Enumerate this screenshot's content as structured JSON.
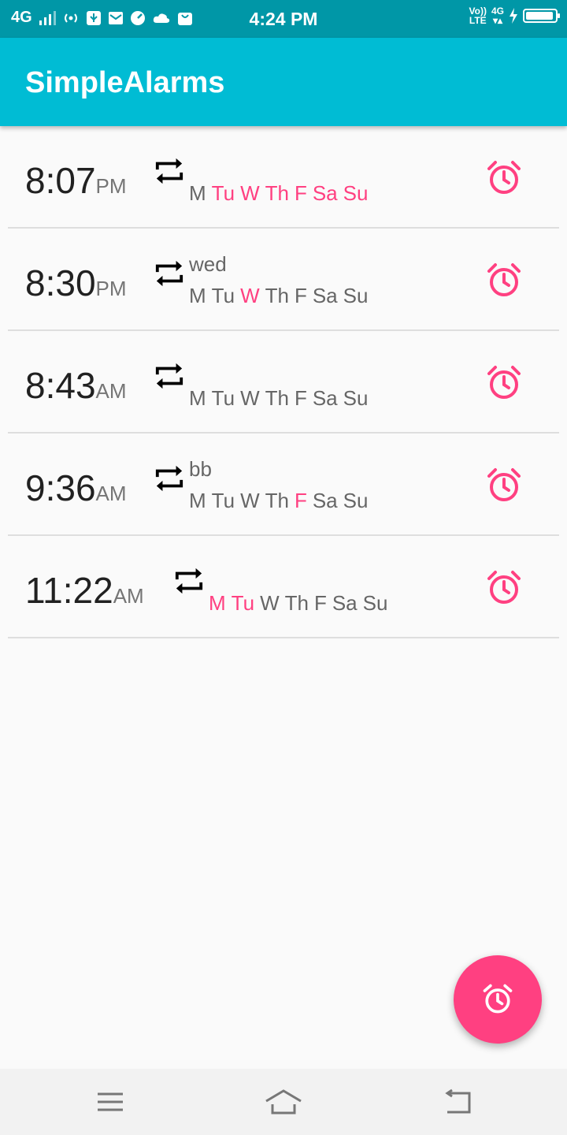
{
  "status_bar": {
    "network": "4G",
    "time": "4:24 PM",
    "volte_top": "Vo))",
    "volte_bottom": "LTE",
    "network_right": "4G",
    "battery_level": 0.95
  },
  "app_bar": {
    "title": "SimpleAlarms"
  },
  "alarms": [
    {
      "time": "8:07",
      "ampm": "PM",
      "label": "",
      "days": [
        "M",
        "Tu",
        "W",
        "Th",
        "F",
        "Sa",
        "Su"
      ],
      "active": [
        false,
        true,
        true,
        true,
        true,
        true,
        true
      ]
    },
    {
      "time": "8:30",
      "ampm": "PM",
      "label": "wed",
      "days": [
        "M",
        "Tu",
        "W",
        "Th",
        "F",
        "Sa",
        "Su"
      ],
      "active": [
        false,
        false,
        true,
        false,
        false,
        false,
        false
      ]
    },
    {
      "time": "8:43",
      "ampm": "AM",
      "label": "",
      "days": [
        "M",
        "Tu",
        "W",
        "Th",
        "F",
        "Sa",
        "Su"
      ],
      "active": [
        false,
        false,
        false,
        false,
        false,
        false,
        false
      ]
    },
    {
      "time": "9:36",
      "ampm": "AM",
      "label": "bb",
      "days": [
        "M",
        "Tu",
        "W",
        "Th",
        "F",
        "Sa",
        "Su"
      ],
      "active": [
        false,
        false,
        false,
        false,
        true,
        false,
        false
      ]
    },
    {
      "time": "11:22",
      "ampm": "AM",
      "label": "",
      "days": [
        "M",
        "Tu",
        "W",
        "Th",
        "F",
        "Sa",
        "Su"
      ],
      "active": [
        true,
        true,
        false,
        false,
        false,
        false,
        false
      ]
    }
  ],
  "colors": {
    "accent": "#ff4081",
    "primary": "#00bcd4",
    "primary_dark": "#0097a7"
  },
  "icons": {
    "repeat": "repeat-icon",
    "alarm": "alarm-clock-icon",
    "fab": "add-alarm-icon",
    "nav": [
      "menu-icon",
      "home-icon",
      "back-icon"
    ]
  }
}
